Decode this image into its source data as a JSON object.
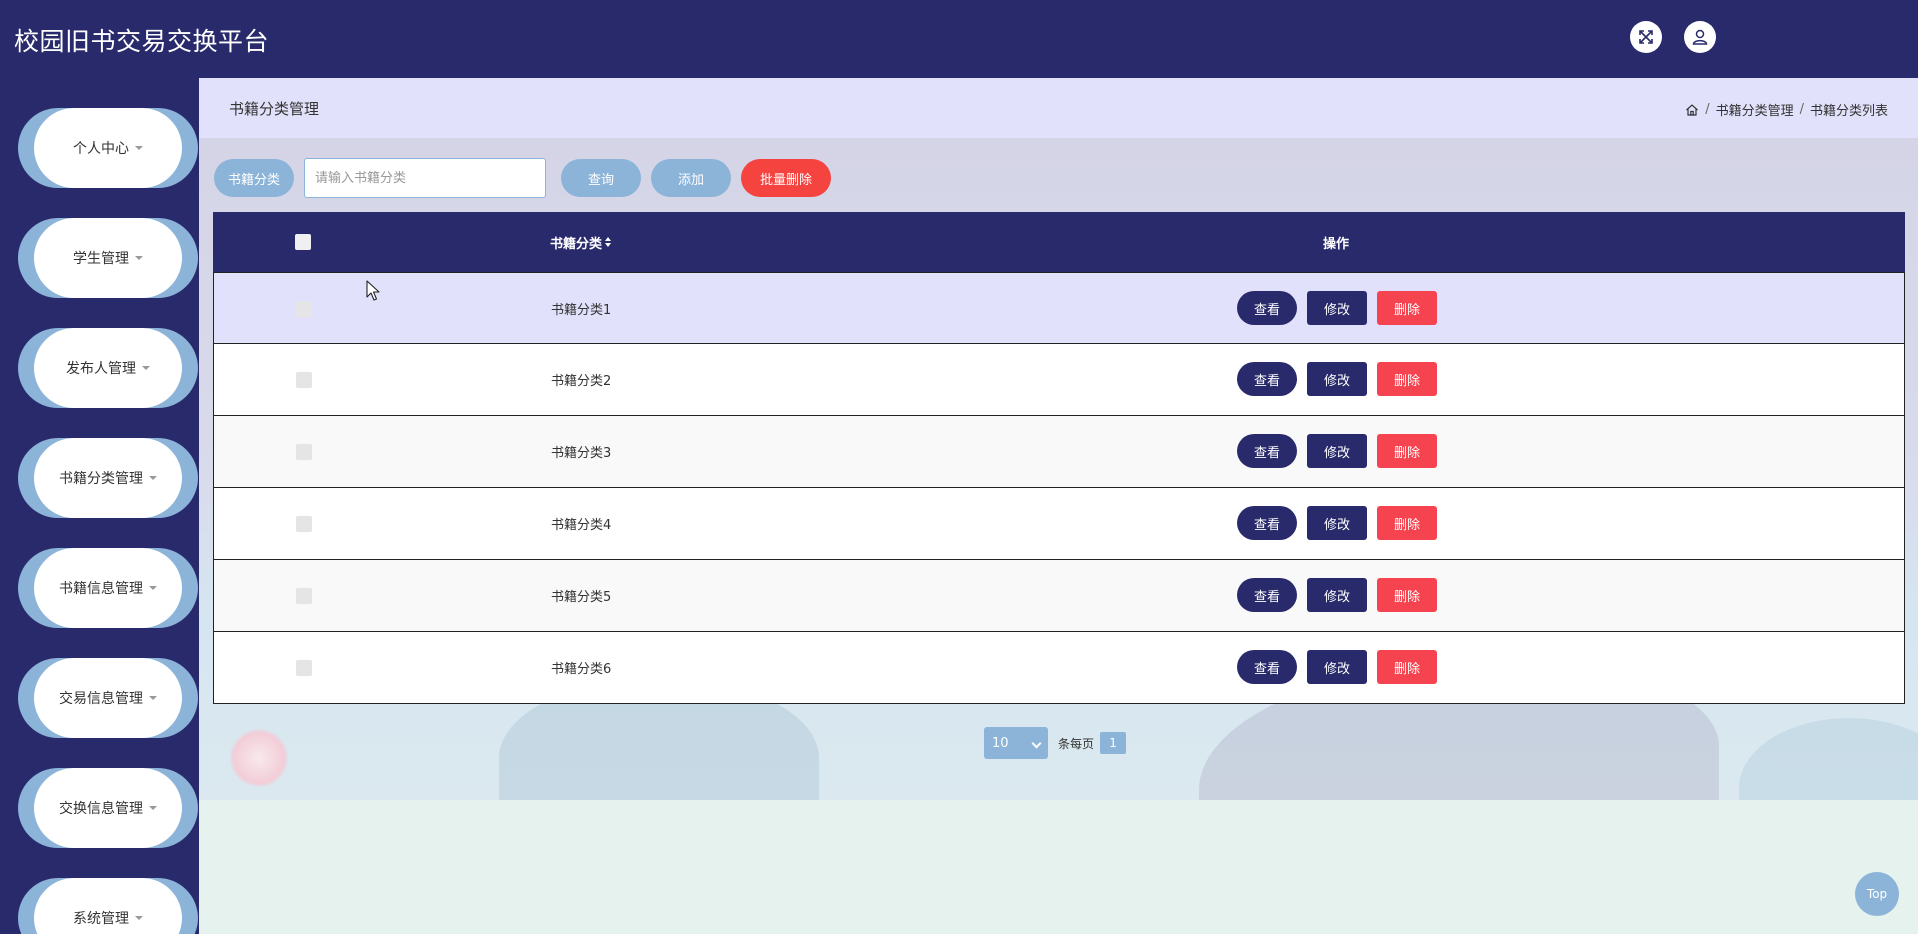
{
  "header": {
    "app_title": "校园旧书交易交换平台",
    "fullscreen_icon": "expand-icon",
    "user_icon": "user-icon"
  },
  "sidebar": {
    "items": [
      {
        "label": "个人中心"
      },
      {
        "label": "学生管理"
      },
      {
        "label": "发布人管理"
      },
      {
        "label": "书籍分类管理"
      },
      {
        "label": "书籍信息管理"
      },
      {
        "label": "交易信息管理"
      },
      {
        "label": "交换信息管理"
      },
      {
        "label": "系统管理"
      }
    ]
  },
  "page": {
    "title": "书籍分类管理",
    "breadcrumb": {
      "home_icon": "home-icon",
      "separator": "/",
      "level1": "书籍分类管理",
      "level2": "书籍分类列表"
    }
  },
  "search": {
    "label": "书籍分类",
    "placeholder": "请输入书籍分类",
    "value": "",
    "query_label": "查询",
    "add_label": "添加",
    "batch_delete_label": "批量删除"
  },
  "table": {
    "columns": [
      "书籍分类",
      "操作"
    ],
    "rows": [
      {
        "name": "书籍分类1",
        "view": "查看",
        "edit": "修改",
        "delete": "删除"
      },
      {
        "name": "书籍分类2",
        "view": "查看",
        "edit": "修改",
        "delete": "删除"
      },
      {
        "name": "书籍分类3",
        "view": "查看",
        "edit": "修改",
        "delete": "删除"
      },
      {
        "name": "书籍分类4",
        "view": "查看",
        "edit": "修改",
        "delete": "删除"
      },
      {
        "name": "书籍分类5",
        "view": "查看",
        "edit": "修改",
        "delete": "删除"
      },
      {
        "name": "书籍分类6",
        "view": "查看",
        "edit": "修改",
        "delete": "删除"
      }
    ]
  },
  "pagination": {
    "page_size": "10",
    "per_page_text": "条每页",
    "current_page": "1"
  },
  "top_button": "Top",
  "colors": {
    "primary": "#292a6c",
    "accent": "#8cb4d9",
    "danger": "#f5434f",
    "highlight_row": "#e1e1fb"
  }
}
